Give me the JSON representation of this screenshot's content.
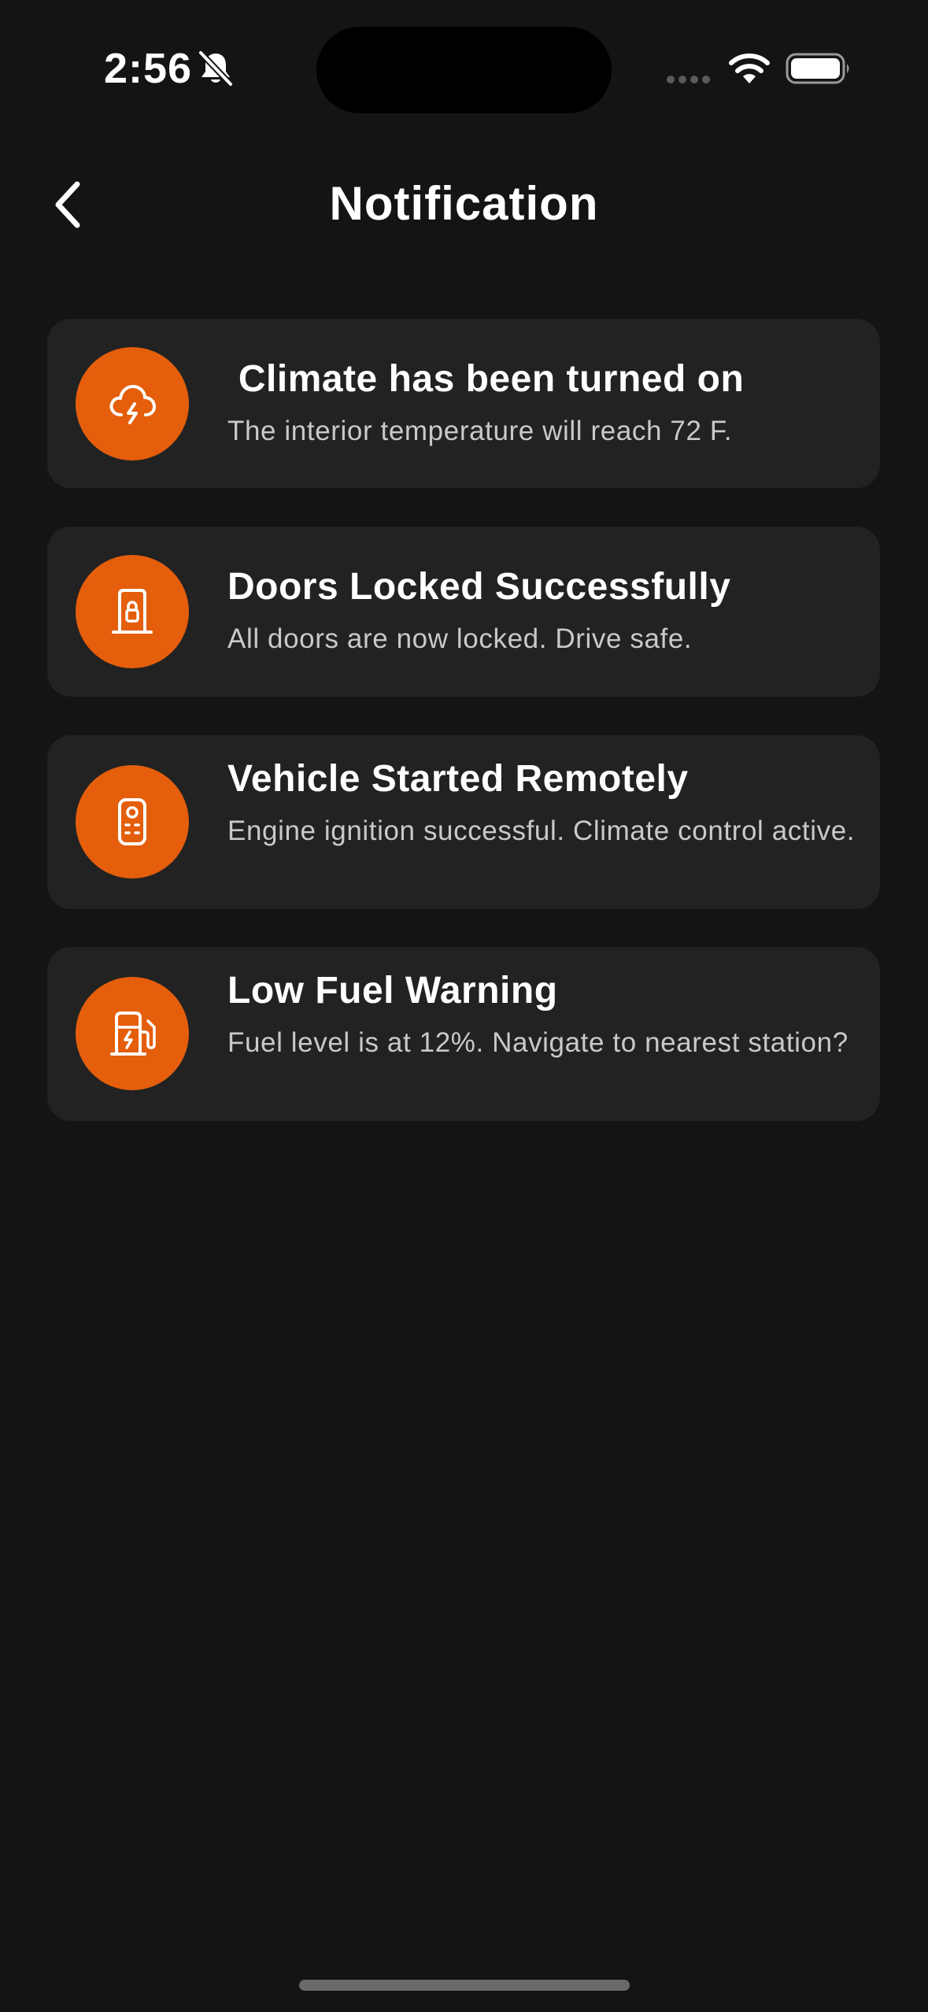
{
  "status_bar": {
    "time": "2:56",
    "icons": [
      "bell-slash-icon",
      "signal-icon",
      "wifi-icon",
      "battery-icon"
    ]
  },
  "header": {
    "title": "Notification",
    "back_icon": "chevron-left-icon"
  },
  "notifications": [
    {
      "icon": "cloud-lightning-icon",
      "title": " Climate has been turned on",
      "message": "The interior temperature will reach 72 F."
    },
    {
      "icon": "door-lock-icon",
      "title": "Doors Locked Successfully",
      "message": "All doors are now locked. Drive safe."
    },
    {
      "icon": "remote-key-icon",
      "title": "Vehicle Started Remotely",
      "message": "Engine ignition successful. Climate control active."
    },
    {
      "icon": "fuel-pump-icon",
      "title": "Low Fuel Warning",
      "message": "Fuel level is at 12%. Navigate to nearest station?"
    }
  ],
  "colors": {
    "background": "#141414",
    "card": "#222222",
    "accent": "#E45E0C",
    "text_primary": "#FFFFFF",
    "text_secondary": "#C9C9C9"
  }
}
